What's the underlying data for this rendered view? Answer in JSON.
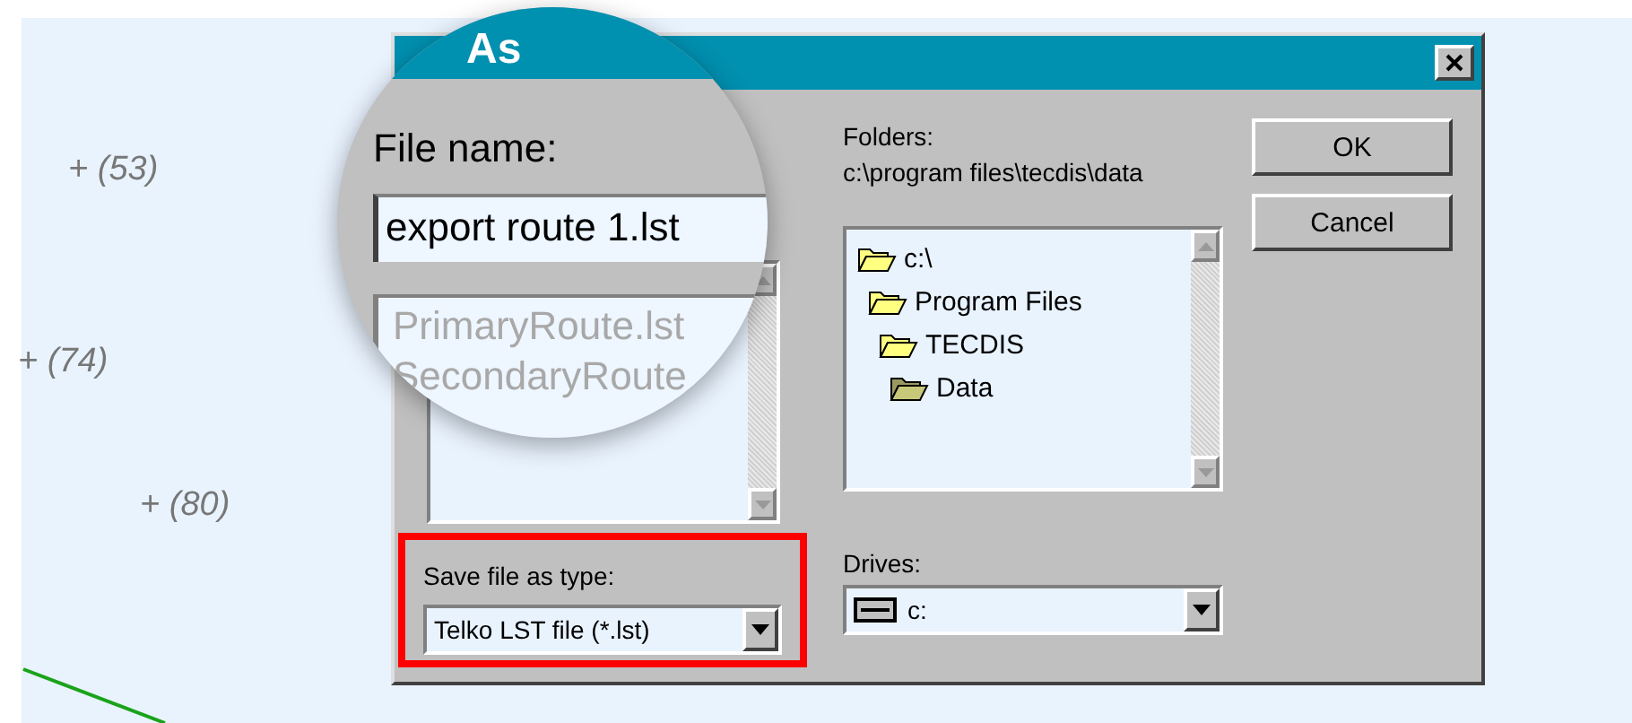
{
  "map_labels": [
    {
      "text": "+ (53)"
    },
    {
      "text": "+ (74)"
    },
    {
      "text": "+ (80)"
    }
  ],
  "dialog": {
    "folders_label": "Folders:",
    "current_path": "c:\\program files\\tecdis\\data",
    "folders": [
      {
        "name": "c:\\",
        "selected": false,
        "children": [
          {
            "name": "Program Files",
            "selected": false,
            "children": [
              {
                "name": "TECDIS",
                "selected": false,
                "children": [
                  {
                    "name": "Data",
                    "selected": true
                  }
                ]
              }
            ]
          }
        ]
      }
    ],
    "save_type": {
      "label": "Save file as type:",
      "value": "Telko LST file (*.lst)",
      "highlighted": true
    },
    "drives": {
      "label": "Drives:",
      "value": "c:"
    },
    "buttons": [
      "OK",
      "Cancel"
    ]
  },
  "magnifier": {
    "title": "As",
    "file_name_label": "File name:",
    "file_name": "export route 1.lst",
    "files": [
      {
        "name": "PrimaryRoute.lst",
        "disabled": true
      },
      {
        "name": "SecondaryRoute",
        "disabled": true
      }
    ]
  }
}
